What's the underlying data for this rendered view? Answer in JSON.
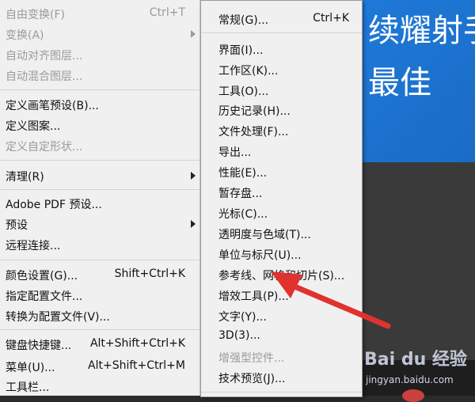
{
  "background": {
    "banner_line1": "续耀射手",
    "banner_line2": "最佳",
    "watermark": "Bai du 经验",
    "watermark_sub": "jingyan.baidu.com"
  },
  "main_menu": {
    "items": [
      {
        "label": "自由变换(F)",
        "shortcut": "Ctrl+T",
        "disabled": true
      },
      {
        "label": "变换(A)",
        "submenu": true,
        "disabled": true
      },
      {
        "label": "自动对齐图层...",
        "disabled": true
      },
      {
        "label": "自动混合图层...",
        "disabled": true
      },
      {
        "label": "定义画笔预设(B)..."
      },
      {
        "label": "定义图案..."
      },
      {
        "label": "定义自定形状...",
        "disabled": true
      },
      {
        "label": "清理(R)",
        "submenu": true
      },
      {
        "label": "Adobe PDF 预设..."
      },
      {
        "label": "预设",
        "submenu": true
      },
      {
        "label": "远程连接..."
      },
      {
        "label": "颜色设置(G)...",
        "shortcut": "Shift+Ctrl+K"
      },
      {
        "label": "指定配置文件..."
      },
      {
        "label": "转换为配置文件(V)..."
      },
      {
        "label": "键盘快捷键...",
        "shortcut": "Alt+Shift+Ctrl+K"
      },
      {
        "label": "菜单(U)...",
        "shortcut": "Alt+Shift+Ctrl+M"
      },
      {
        "label": "工具栏..."
      }
    ]
  },
  "sub_menu": {
    "items": [
      {
        "label": "常规(G)...",
        "shortcut": "Ctrl+K"
      },
      {
        "label": "界面(I)..."
      },
      {
        "label": "工作区(K)..."
      },
      {
        "label": "工具(O)..."
      },
      {
        "label": "历史记录(H)..."
      },
      {
        "label": "文件处理(F)..."
      },
      {
        "label": "导出..."
      },
      {
        "label": "性能(E)..."
      },
      {
        "label": "暂存盘..."
      },
      {
        "label": "光标(C)..."
      },
      {
        "label": "透明度与色域(T)..."
      },
      {
        "label": "单位与标尺(U)..."
      },
      {
        "label": "参考线、网格和切片(S)..."
      },
      {
        "label": "增效工具(P)..."
      },
      {
        "label": "文字(Y)..."
      },
      {
        "label": "3D(3)..."
      },
      {
        "label": "增强型控件...",
        "disabled": true
      },
      {
        "label": "技术预览(J)..."
      }
    ]
  },
  "colors": {
    "menu_bg": "#f0f0f0",
    "disabled_text": "#9a9a9a",
    "annotation_arrow": "#e0322f",
    "banner_blue": "#1f79d8"
  }
}
